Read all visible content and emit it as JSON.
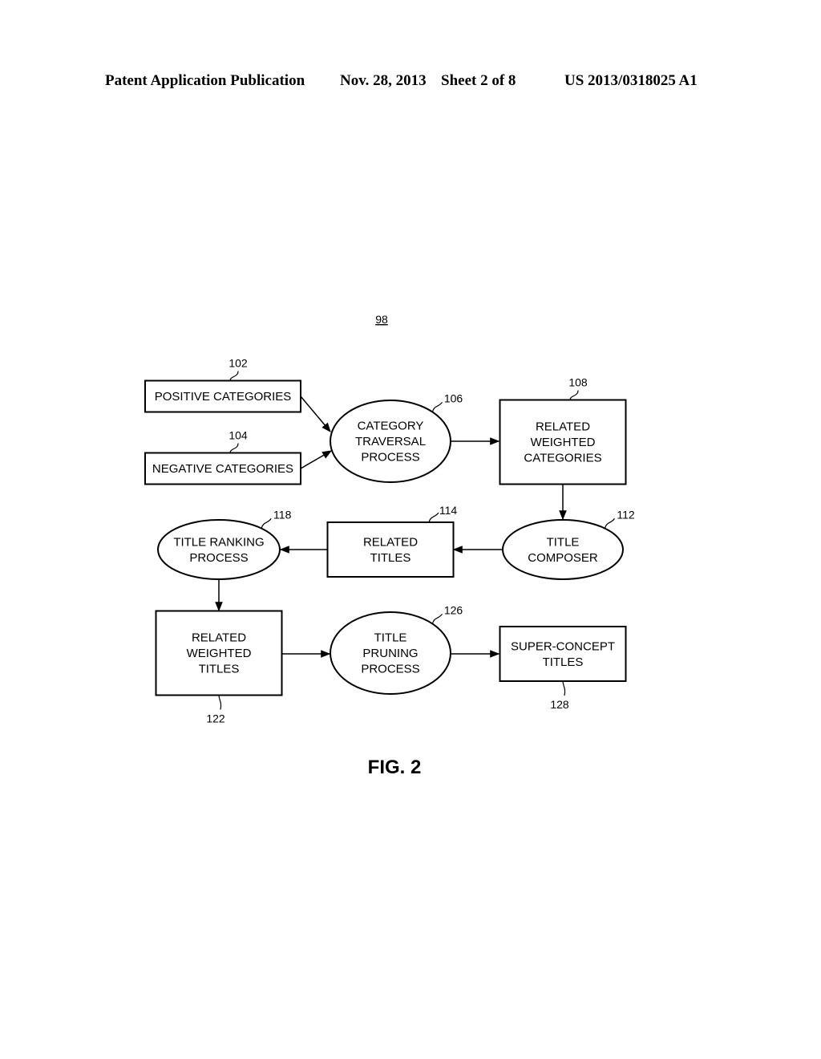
{
  "header": {
    "publication": "Patent Application Publication",
    "date": "Nov. 28, 2013",
    "sheet": "Sheet 2 of 8",
    "number": "US 2013/0318025 A1"
  },
  "diagram": {
    "ref": "98",
    "figure": "FIG. 2",
    "nodes": [
      {
        "id": "102",
        "shape": "rect",
        "ref": "102",
        "lines": [
          "POSITIVE CATEGORIES"
        ]
      },
      {
        "id": "104",
        "shape": "rect",
        "ref": "104",
        "lines": [
          "NEGATIVE CATEGORIES"
        ]
      },
      {
        "id": "106",
        "shape": "ellipse",
        "ref": "106",
        "lines": [
          "CATEGORY",
          "TRAVERSAL",
          "PROCESS"
        ]
      },
      {
        "id": "108",
        "shape": "rect",
        "ref": "108",
        "lines": [
          "RELATED",
          "WEIGHTED",
          "CATEGORIES"
        ]
      },
      {
        "id": "112",
        "shape": "ellipse",
        "ref": "112",
        "lines": [
          "TITLE",
          "COMPOSER"
        ]
      },
      {
        "id": "114",
        "shape": "rect",
        "ref": "114",
        "lines": [
          "RELATED",
          "TITLES"
        ]
      },
      {
        "id": "118",
        "shape": "ellipse",
        "ref": "118",
        "lines": [
          "TITLE RANKING",
          "PROCESS"
        ]
      },
      {
        "id": "122",
        "shape": "rect",
        "ref": "122",
        "lines": [
          "RELATED",
          "WEIGHTED",
          "TITLES"
        ]
      },
      {
        "id": "126",
        "shape": "ellipse",
        "ref": "126",
        "lines": [
          "TITLE",
          "PRUNING",
          "PROCESS"
        ]
      },
      {
        "id": "128",
        "shape": "rect",
        "ref": "128",
        "lines": [
          "SUPER-CONCEPT",
          "TITLES"
        ]
      }
    ],
    "edges": [
      {
        "from": "102",
        "to": "106"
      },
      {
        "from": "104",
        "to": "106"
      },
      {
        "from": "106",
        "to": "108"
      },
      {
        "from": "108",
        "to": "112"
      },
      {
        "from": "112",
        "to": "114"
      },
      {
        "from": "114",
        "to": "118"
      },
      {
        "from": "118",
        "to": "122"
      },
      {
        "from": "122",
        "to": "126"
      },
      {
        "from": "126",
        "to": "128"
      }
    ]
  }
}
